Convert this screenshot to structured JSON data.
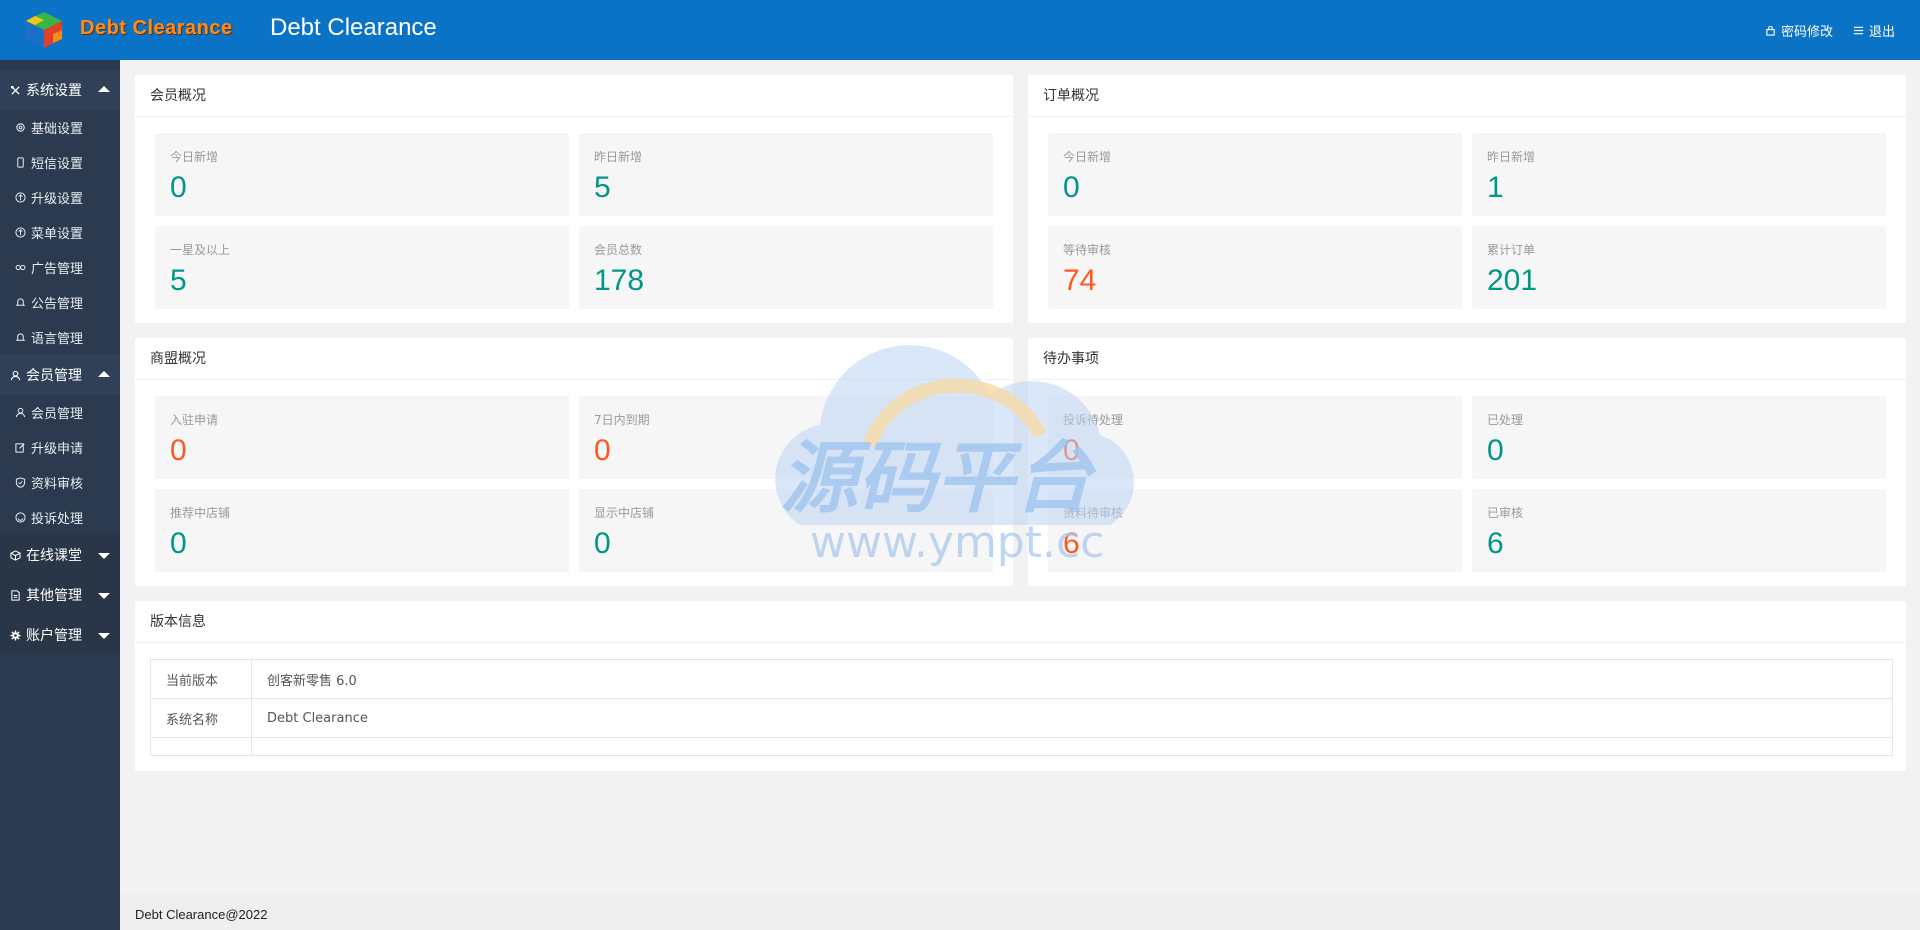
{
  "header": {
    "logo_text": "Debt Clearance",
    "title": "Debt Clearance",
    "change_password": "密码修改",
    "logout": "退出"
  },
  "sidebar": {
    "groups": [
      {
        "label": "系统设置",
        "icon": "tools-icon",
        "open": true,
        "items": [
          {
            "label": "基础设置",
            "icon": "gear-icon"
          },
          {
            "label": "短信设置",
            "icon": "phone-icon"
          },
          {
            "label": "升级设置",
            "icon": "upgrade-icon"
          },
          {
            "label": "菜单设置",
            "icon": "upgrade-icon"
          },
          {
            "label": "广告管理",
            "icon": "link-icon"
          },
          {
            "label": "公告管理",
            "icon": "bell-icon"
          },
          {
            "label": "语言管理",
            "icon": "bell-icon"
          }
        ]
      },
      {
        "label": "会员管理",
        "icon": "user-icon",
        "open": true,
        "items": [
          {
            "label": "会员管理",
            "icon": "user-icon"
          },
          {
            "label": "升级申请",
            "icon": "edit-icon"
          },
          {
            "label": "资料审核",
            "icon": "shield-check-icon"
          },
          {
            "label": "投诉处理",
            "icon": "smile-icon"
          }
        ]
      },
      {
        "label": "在线课堂",
        "icon": "cube-icon",
        "open": false
      },
      {
        "label": "其他管理",
        "icon": "doc-icon",
        "open": false
      },
      {
        "label": "账户管理",
        "icon": "cog-icon",
        "open": false
      }
    ]
  },
  "member_overview": {
    "title": "会员概况",
    "stats": [
      {
        "label": "今日新增",
        "value": "0",
        "color": "#009688"
      },
      {
        "label": "昨日新增",
        "value": "5",
        "color": "#009688"
      },
      {
        "label": "一星及以上",
        "value": "5",
        "color": "#009688"
      },
      {
        "label": "会员总数",
        "value": "178",
        "color": "#009688"
      }
    ]
  },
  "order_overview": {
    "title": "订单概况",
    "stats": [
      {
        "label": "今日新增",
        "value": "0",
        "color": "#009688"
      },
      {
        "label": "昨日新增",
        "value": "1",
        "color": "#009688"
      },
      {
        "label": "等待审核",
        "value": "74",
        "color": "#ff5722"
      },
      {
        "label": "累计订单",
        "value": "201",
        "color": "#009688"
      }
    ]
  },
  "merchant_overview": {
    "title": "商盟概况",
    "stats": [
      {
        "label": "入驻申请",
        "value": "0",
        "color": "#ff5722"
      },
      {
        "label": "7日内到期",
        "value": "0",
        "color": "#ff5722"
      },
      {
        "label": "推荐中店铺",
        "value": "0",
        "color": "#009688"
      },
      {
        "label": "显示中店铺",
        "value": "0",
        "color": "#009688"
      }
    ]
  },
  "todo": {
    "title": "待办事项",
    "stats": [
      {
        "label": "投诉待处理",
        "value": "0",
        "color": "#ff5722"
      },
      {
        "label": "已处理",
        "value": "0",
        "color": "#009688"
      },
      {
        "label": "资料待审核",
        "value": "6",
        "color": "#ff5722"
      },
      {
        "label": "已审核",
        "value": "6",
        "color": "#009688"
      }
    ]
  },
  "version": {
    "title": "版本信息",
    "rows": [
      {
        "key": "当前版本",
        "value": "创客新零售 6.0"
      },
      {
        "key": "系统名称",
        "value": "Debt Clearance"
      }
    ]
  },
  "watermark": {
    "text_cn": "源码平台",
    "text_url": "www.ympt.cc"
  },
  "footer": {
    "text": "Debt Clearance@2022"
  }
}
